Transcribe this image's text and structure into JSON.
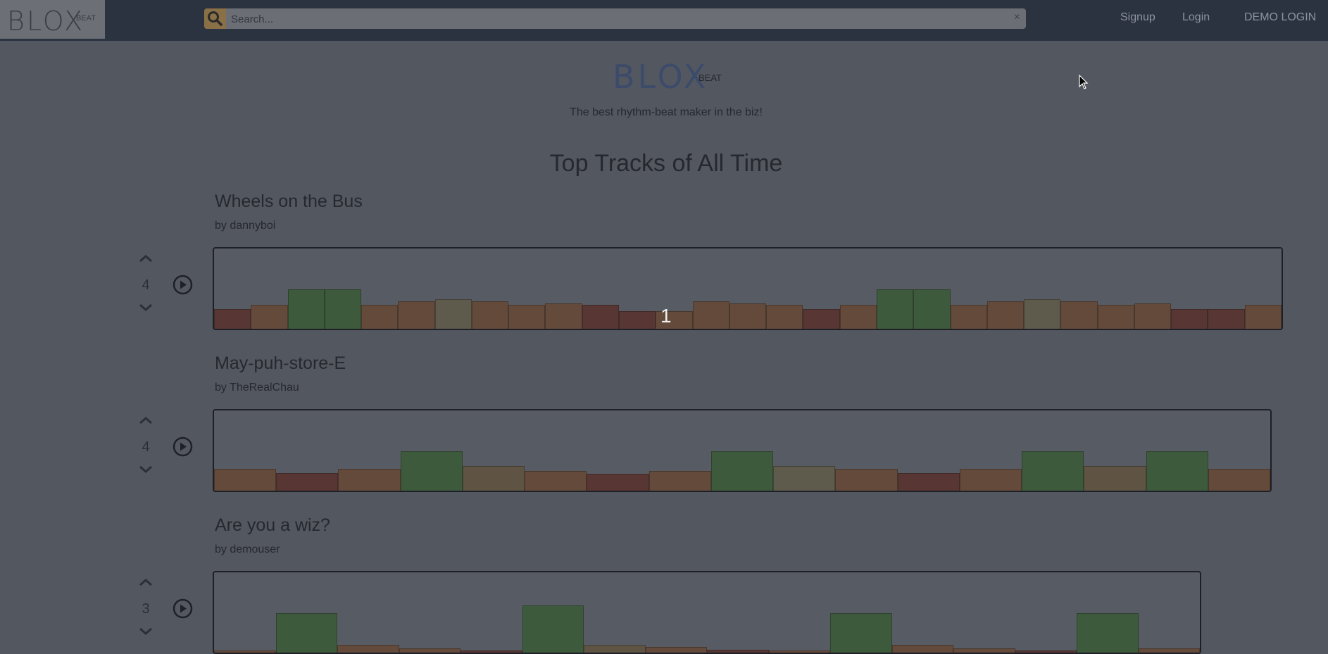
{
  "header": {
    "logo_text": "BLOX",
    "logo_sub": "BEAT",
    "search_placeholder": "Search...",
    "search_clear": "×",
    "nav": [
      {
        "label": "Signup"
      },
      {
        "label": "Login"
      },
      {
        "label": "DEMO LOGIN"
      }
    ]
  },
  "hero": {
    "logo_text": "BLOX",
    "logo_sub": "BEAT",
    "tagline": "The best rhythm-beat maker in the biz!"
  },
  "page_title": "Top Tracks of All Time",
  "colors": {
    "brown": "#644a3a",
    "dark_red": "#583633",
    "tan": "#5f5443",
    "green": "#3e5a3c",
    "olive": "#5e5a4c"
  },
  "tracks": [
    {
      "title": "Wheels on the Bus",
      "author": "by dannyboi",
      "votes": "4",
      "beat_indicator": "1",
      "blocks": [
        {
          "c": "dark_red",
          "l": 0.5
        },
        {
          "c": "brown",
          "l": 0.6
        },
        {
          "c": "green",
          "l": 1.0
        },
        {
          "c": "green",
          "l": 1.0
        },
        {
          "c": "brown",
          "l": 0.6
        },
        {
          "c": "brown",
          "l": 0.7
        },
        {
          "c": "olive",
          "l": 0.75
        },
        {
          "c": "brown",
          "l": 0.7
        },
        {
          "c": "brown",
          "l": 0.6
        },
        {
          "c": "brown",
          "l": 0.65
        },
        {
          "c": "dark_red",
          "l": 0.6
        },
        {
          "c": "dark_red",
          "l": 0.45
        },
        {
          "c": "brown",
          "l": 0.45
        },
        {
          "c": "brown",
          "l": 0.7
        },
        {
          "c": "brown",
          "l": 0.65
        },
        {
          "c": "brown",
          "l": 0.6
        },
        {
          "c": "dark_red",
          "l": 0.5
        },
        {
          "c": "brown",
          "l": 0.6
        },
        {
          "c": "green",
          "l": 1.0
        },
        {
          "c": "green",
          "l": 1.0
        },
        {
          "c": "brown",
          "l": 0.6
        },
        {
          "c": "brown",
          "l": 0.7
        },
        {
          "c": "olive",
          "l": 0.75
        },
        {
          "c": "brown",
          "l": 0.7
        },
        {
          "c": "brown",
          "l": 0.6
        },
        {
          "c": "brown",
          "l": 0.65
        },
        {
          "c": "dark_red",
          "l": 0.5
        },
        {
          "c": "dark_red",
          "l": 0.5
        },
        {
          "c": "brown",
          "l": 0.6
        }
      ]
    },
    {
      "title": "May-puh-store-E",
      "author": "by TheRealChau",
      "votes": "4",
      "blocks": [
        {
          "c": "brown",
          "l": 0.55
        },
        {
          "c": "dark_red",
          "l": 0.45
        },
        {
          "c": "brown",
          "l": 0.55
        },
        {
          "c": "green",
          "l": 1.0
        },
        {
          "c": "tan",
          "l": 0.62
        },
        {
          "c": "brown",
          "l": 0.5
        },
        {
          "c": "dark_red",
          "l": 0.42
        },
        {
          "c": "brown",
          "l": 0.5
        },
        {
          "c": "green",
          "l": 1.0
        },
        {
          "c": "olive",
          "l": 0.62
        },
        {
          "c": "brown",
          "l": 0.55
        },
        {
          "c": "dark_red",
          "l": 0.45
        },
        {
          "c": "brown",
          "l": 0.55
        },
        {
          "c": "green",
          "l": 1.0
        },
        {
          "c": "tan",
          "l": 0.62
        },
        {
          "c": "green",
          "l": 1.0
        },
        {
          "c": "brown",
          "l": 0.55
        }
      ]
    },
    {
      "title": "Are you a wiz?",
      "author": "by demouser",
      "votes": "3",
      "blocks": [
        {
          "c": "brown",
          "l": 0.05
        },
        {
          "c": "green",
          "l": 1.0
        },
        {
          "c": "brown",
          "l": 0.2
        },
        {
          "c": "brown",
          "l": 0.1
        },
        {
          "c": "dark_red",
          "l": 0.05
        },
        {
          "c": "green",
          "l": 1.2
        },
        {
          "c": "tan",
          "l": 0.2
        },
        {
          "c": "brown",
          "l": 0.15
        },
        {
          "c": "dark_red",
          "l": 0.08
        },
        {
          "c": "brown",
          "l": 0.05
        },
        {
          "c": "green",
          "l": 1.0
        },
        {
          "c": "brown",
          "l": 0.2
        },
        {
          "c": "brown",
          "l": 0.1
        },
        {
          "c": "dark_red",
          "l": 0.05
        },
        {
          "c": "green",
          "l": 1.0
        },
        {
          "c": "brown",
          "l": 0.1
        }
      ]
    }
  ]
}
